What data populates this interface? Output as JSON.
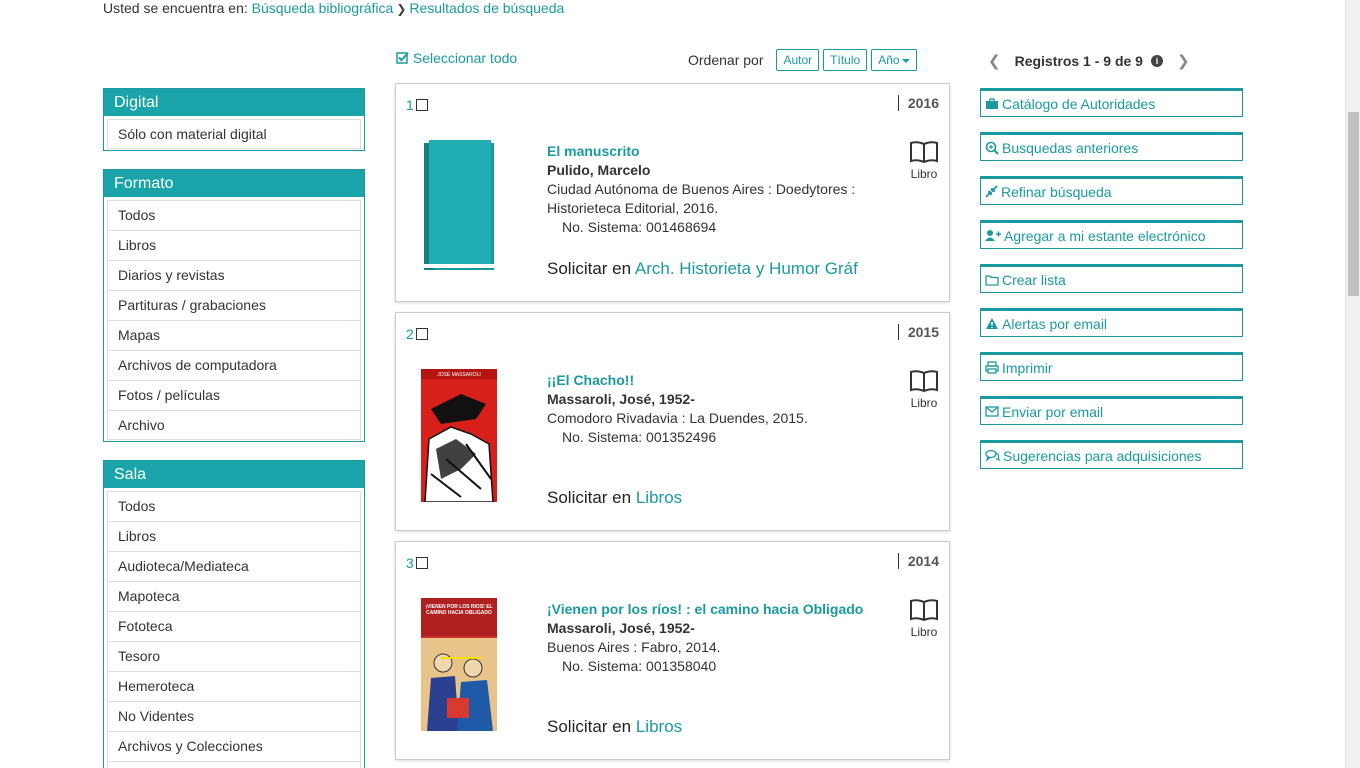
{
  "breadcrumb": {
    "prefix": "Usted se encuentra en:",
    "items": [
      "Búsqueda bibliográfica",
      "Resultados de búsqueda"
    ]
  },
  "toolbar": {
    "select_all": "Seleccionar todo",
    "sort_label": "Ordenar por",
    "sort_author": "Autor",
    "sort_title": "Título",
    "sort_year": "Año"
  },
  "facets": {
    "digital": {
      "title": "Digital",
      "items": [
        "Sólo con material digital"
      ]
    },
    "formato": {
      "title": "Formato",
      "items": [
        "Todos",
        "Libros",
        "Diarios y revistas",
        "Partituras / grabaciones",
        "Mapas",
        "Archivos de computadora",
        "Fotos / películas",
        "Archivo"
      ]
    },
    "sala": {
      "title": "Sala",
      "items": [
        "Todos",
        "Libros",
        "Audioteca/Mediateca",
        "Mapoteca",
        "Fototeca",
        "Tesoro",
        "Hemeroteca",
        "No Videntes",
        "Archivos y Colecciones"
      ]
    }
  },
  "records": [
    {
      "num": "1",
      "year": "2016",
      "title": "El manuscrito",
      "author": "Pulido, Marcelo",
      "pub": "Ciudad Autónoma de Buenos Aires : Doedytores : Historieteca Editorial, 2016.",
      "system": "No. Sistema: 001468694",
      "solicit": "Solicitar en",
      "location": "Arch. Historieta y Humor Gráf",
      "type": "Libro"
    },
    {
      "num": "2",
      "year": "2015",
      "title": "¡¡El Chacho!!",
      "author": "Massaroli, José, 1952-",
      "pub": "Comodoro Rivadavia : La Duendes, 2015.",
      "system": "No. Sistema: 001352496",
      "solicit": "Solicitar en",
      "location": "Libros",
      "type": "Libro",
      "cover_text": "JOSÉ MASSAROLI"
    },
    {
      "num": "3",
      "year": "2014",
      "title": "¡Vienen por los ríos! : el camino hacia Obligado",
      "author": "Massaroli, José, 1952-",
      "pub": "Buenos Aires : Fabro, 2014.",
      "system": "No. Sistema: 001358040",
      "solicit": "Solicitar en",
      "location": "Libros",
      "type": "Libro",
      "cover_text": "¡VIENEN POR LOS RÍOS! EL CAMINO HACIA OBLIGADO"
    }
  ],
  "pager": {
    "label": "Registros 1 - 9 de 9"
  },
  "actions": [
    "Catálogo de Autoridades",
    "Busquedas anteriores",
    "Refinar búsqueda",
    "Agregar a mi estante electrónico",
    "Crear lista",
    "Alertas por email",
    "Imprimir",
    "Enviar por email",
    "Sugerencias para adquisiciones"
  ],
  "colors": {
    "accent": "#1a9aa0",
    "facet_header": "#1aa3a8"
  }
}
